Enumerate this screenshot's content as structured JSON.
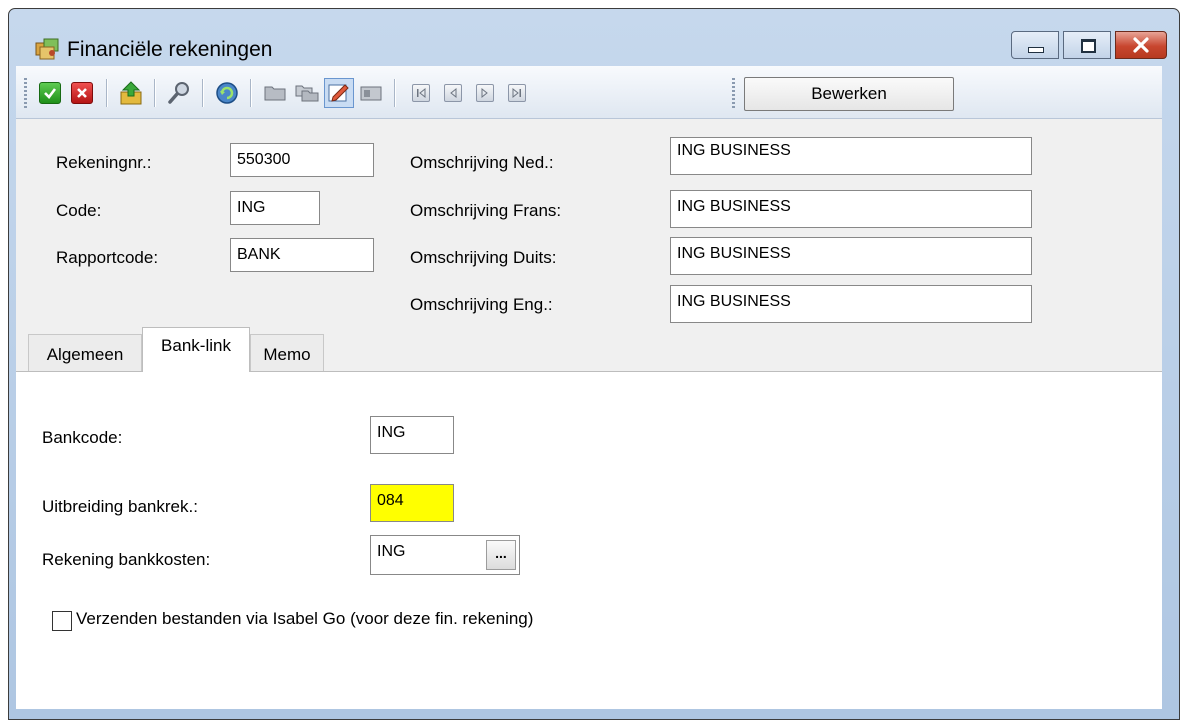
{
  "window": {
    "title": "Financiële rekeningen"
  },
  "toolbar": {
    "icons": [
      "save-check-icon",
      "cancel-x-icon",
      "export-icon",
      "search-icon",
      "refresh-icon",
      "folder-icon",
      "folders-icon",
      "edit-form-icon",
      "card-icon",
      "first-record-icon",
      "previous-record-icon",
      "next-record-icon",
      "last-record-icon"
    ],
    "mode_label": "Bewerken"
  },
  "header": {
    "rekeningnr_label": "Rekeningnr.:",
    "rekeningnr_value": "550300",
    "code_label": "Code:",
    "code_value": "ING",
    "rapportcode_label": "Rapportcode:",
    "rapportcode_value": "BANK",
    "omschr_ned_label": "Omschrijving Ned.:",
    "omschr_ned_value": "ING BUSINESS",
    "omschr_frans_label": "Omschrijving Frans:",
    "omschr_frans_value": "ING BUSINESS",
    "omschr_duits_label": "Omschrijving Duits:",
    "omschr_duits_value": "ING BUSINESS",
    "omschr_eng_label": "Omschrijving Eng.:",
    "omschr_eng_value": "ING BUSINESS"
  },
  "tabs": [
    {
      "label": "Algemeen",
      "active": false
    },
    {
      "label": "Bank-link",
      "active": true
    },
    {
      "label": "Memo",
      "active": false
    }
  ],
  "banklink": {
    "bankcode_label": "Bankcode:",
    "bankcode_value": "ING",
    "uitbreiding_label": "Uitbreiding bankrek.:",
    "uitbreiding_value": "084",
    "bankkosten_label": "Rekening bankkosten:",
    "bankkosten_value": "ING",
    "browse_label": "...",
    "isabel_label": "Verzenden bestanden via Isabel Go (voor deze fin. rekening)",
    "isabel_checked": false
  },
  "colors": {
    "highlight_field": "#ffff00",
    "title_bar": "#c6d8ed",
    "close_button": "#c8462f"
  }
}
